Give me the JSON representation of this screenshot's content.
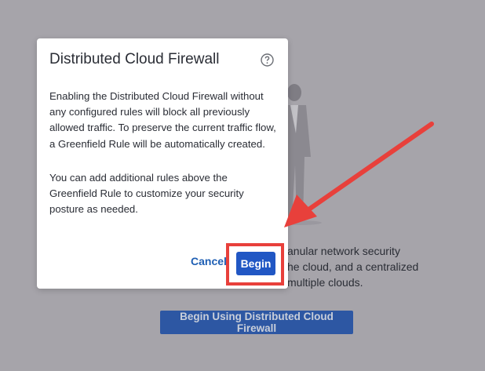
{
  "background": {
    "text_lines": [
      "anular network security",
      "he cloud, and a centralized",
      "multiple clouds."
    ],
    "cta_label": "Begin Using Distributed Cloud Firewall"
  },
  "modal": {
    "title": "Distributed Cloud Firewall",
    "help_icon": "question-circle-icon",
    "paragraphs": [
      "Enabling the Distributed Cloud Firewall without any configured rules will block all previously allowed traffic. To preserve the current traffic flow, a Greenfield Rule will be automatically created.",
      "You can add additional rules above the Greenfield Rule to customize your security posture as needed."
    ],
    "cancel_label": "Cancel",
    "begin_label": "Begin"
  },
  "annotation": {
    "color": "#e8403b"
  }
}
